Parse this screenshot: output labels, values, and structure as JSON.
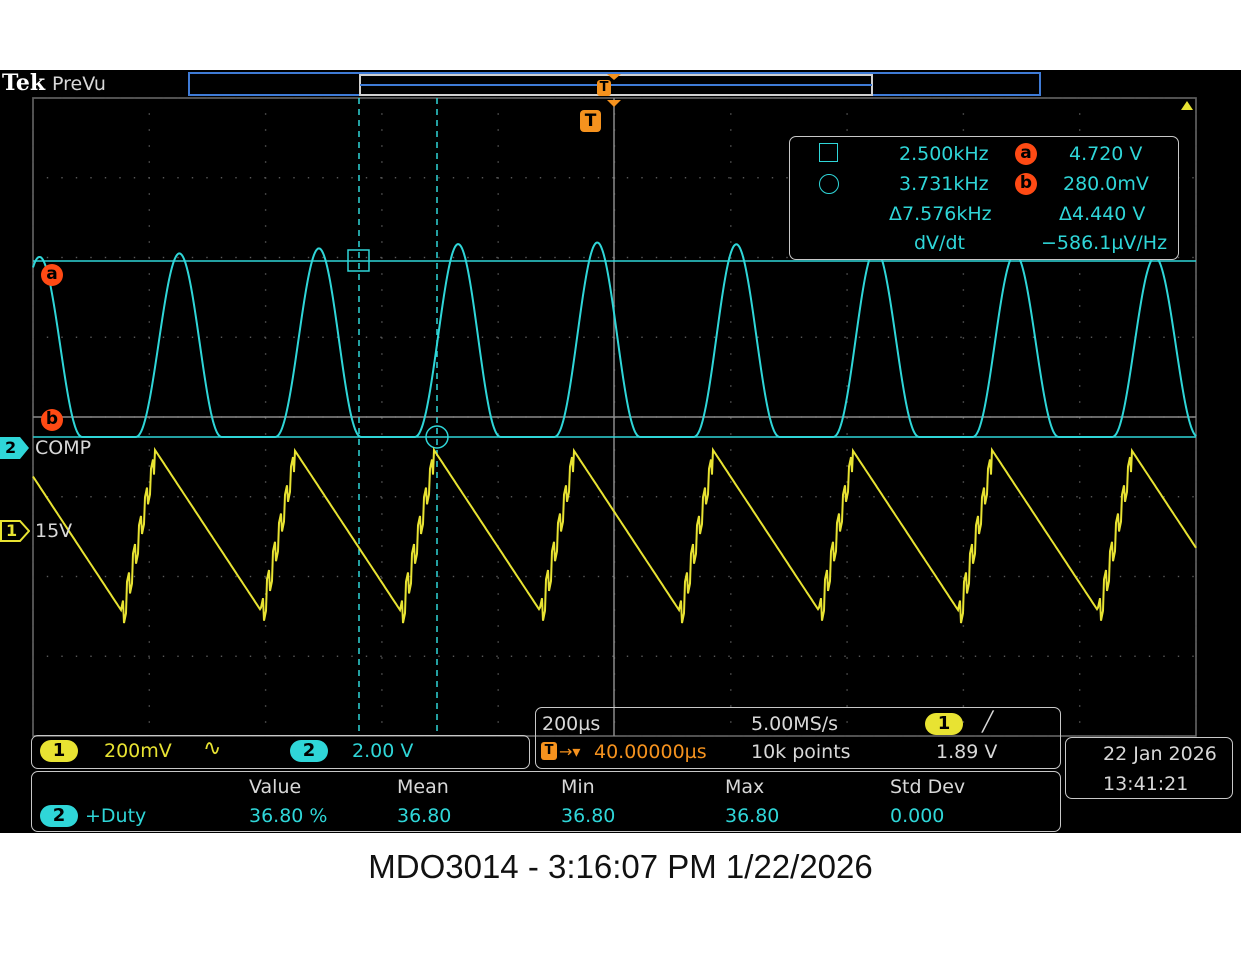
{
  "brand": {
    "logo": "Tek",
    "mode": "PreVu"
  },
  "trigger": {
    "marker": "T"
  },
  "cursor_readout": {
    "row1": {
      "freq": "2.500kHz",
      "tag": "a",
      "value": "4.720 V"
    },
    "row2": {
      "freq": "3.731kHz",
      "tag": "b",
      "value": "280.0mV"
    },
    "row3": {
      "dfreq": "Δ7.576kHz",
      "dval": "Δ4.440 V"
    },
    "row4": {
      "label": "dV/dt",
      "value": "−586.1µV/Hz"
    }
  },
  "markers": {
    "a": "a",
    "b": "b"
  },
  "channels": {
    "ch2": {
      "num": "2",
      "label": "COMP",
      "scale": "2.00 V",
      "color": "#2fd6d8"
    },
    "ch1": {
      "num": "1",
      "label": "15V",
      "scale": "200mV",
      "coupling": "∿",
      "color": "#e8e332"
    }
  },
  "timebase": {
    "scale": "200µs",
    "rate": "5.00MS/s",
    "points": "10k points",
    "trigger_pos": "40.00000µs",
    "trig_ch": "1",
    "trig_slope": "╱",
    "trig_level": "1.89 V"
  },
  "datetime": {
    "date": "22 Jan  2026",
    "time": "13:41:21"
  },
  "measurement": {
    "headers": [
      "Value",
      "Mean",
      "Min",
      "Max",
      "Std Dev"
    ],
    "channel": "2",
    "name": "+Duty",
    "values": [
      "36.80 %",
      "36.80",
      "36.80",
      "36.80",
      "0.000"
    ]
  },
  "caption": "MDO3014 - 3:16:07 PM    1/22/2026",
  "colors": {
    "cyan": "#2fd6d8",
    "yellow": "#e8e332",
    "orange": "#f5921e",
    "cursor_tag": "#ff4a14"
  }
}
